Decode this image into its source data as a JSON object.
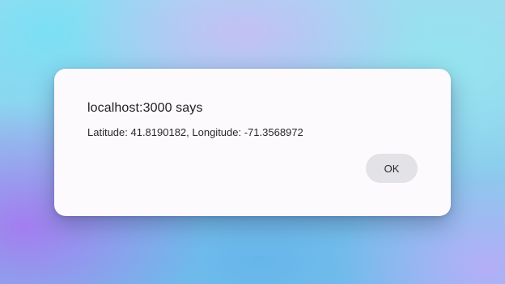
{
  "dialog": {
    "title": "localhost:3000 says",
    "message": "Latitude: 41.8190182, Longitude: -71.3568972",
    "ok_label": "OK"
  },
  "colors": {
    "dialog_background": "#fcfafd",
    "button_background": "#e3e2e7",
    "text": "#1f1f1f"
  }
}
